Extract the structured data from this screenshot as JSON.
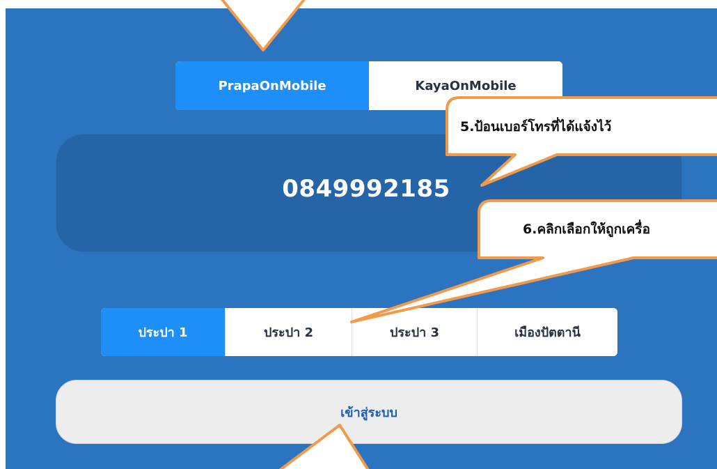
{
  "app_tabs": [
    {
      "label": "PrapaOnMobile",
      "selected": true
    },
    {
      "label": "KayaOnMobile",
      "selected": false
    }
  ],
  "phone_field": {
    "value": "0849992185"
  },
  "branch_tabs": [
    {
      "label": "ประปา 1",
      "selected": true
    },
    {
      "label": "ประปา 2",
      "selected": false
    },
    {
      "label": "ประปา 3",
      "selected": false
    },
    {
      "label": "เมืองปัตตานี",
      "selected": false
    }
  ],
  "login_button": {
    "label": "เข้าสู่ระบบ"
  },
  "callouts": [
    {
      "text": "5.ป้อนเบอร์โทรที่ได้แจ้งไว้"
    },
    {
      "text": "6.คลิกเลือกให้ถูกเครื่อ"
    }
  ],
  "colors": {
    "background": "#2c74bf",
    "active_segment": "#1e8ef8",
    "phone_box": "#2664a8",
    "callout_fill": "#ffffff",
    "callout_border": "#f29a4a"
  }
}
